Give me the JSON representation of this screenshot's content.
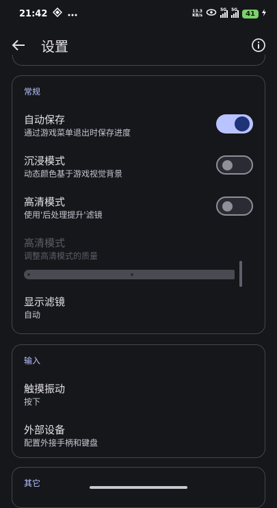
{
  "status_bar": {
    "time": "21:42",
    "net_speed_value": "13.3",
    "net_speed_unit": "KB/s",
    "sim1_type": "5G",
    "sim2_type": "5G",
    "battery": "41"
  },
  "header": {
    "title": "设置"
  },
  "general": {
    "section_title": "常规",
    "auto_save": {
      "title": "自动保存",
      "subtitle": "通过游戏菜单退出时保存进度",
      "enabled": true
    },
    "immersive": {
      "title": "沉浸模式",
      "subtitle": "动态颜色基于游戏视觉背景",
      "enabled": false
    },
    "hd_mode": {
      "title": "高清模式",
      "subtitle": "使用'后处理提升'滤镜",
      "enabled": false
    },
    "hd_quality": {
      "title": "高清模式",
      "subtitle": "调整高清模式的质量"
    },
    "display_filter": {
      "title": "显示滤镜",
      "value": "自动"
    }
  },
  "input": {
    "section_title": "输入",
    "haptics": {
      "title": "触摸振动",
      "value": "按下"
    },
    "external_devices": {
      "title": "外部设备",
      "subtitle": "配置外接手柄和键盘"
    }
  },
  "other": {
    "section_title": "其它"
  },
  "colors": {
    "background": "#16171b",
    "accent": "#b9c3ff",
    "toggle_knob_on": "#1f3478",
    "battery": "#7bd26a"
  }
}
